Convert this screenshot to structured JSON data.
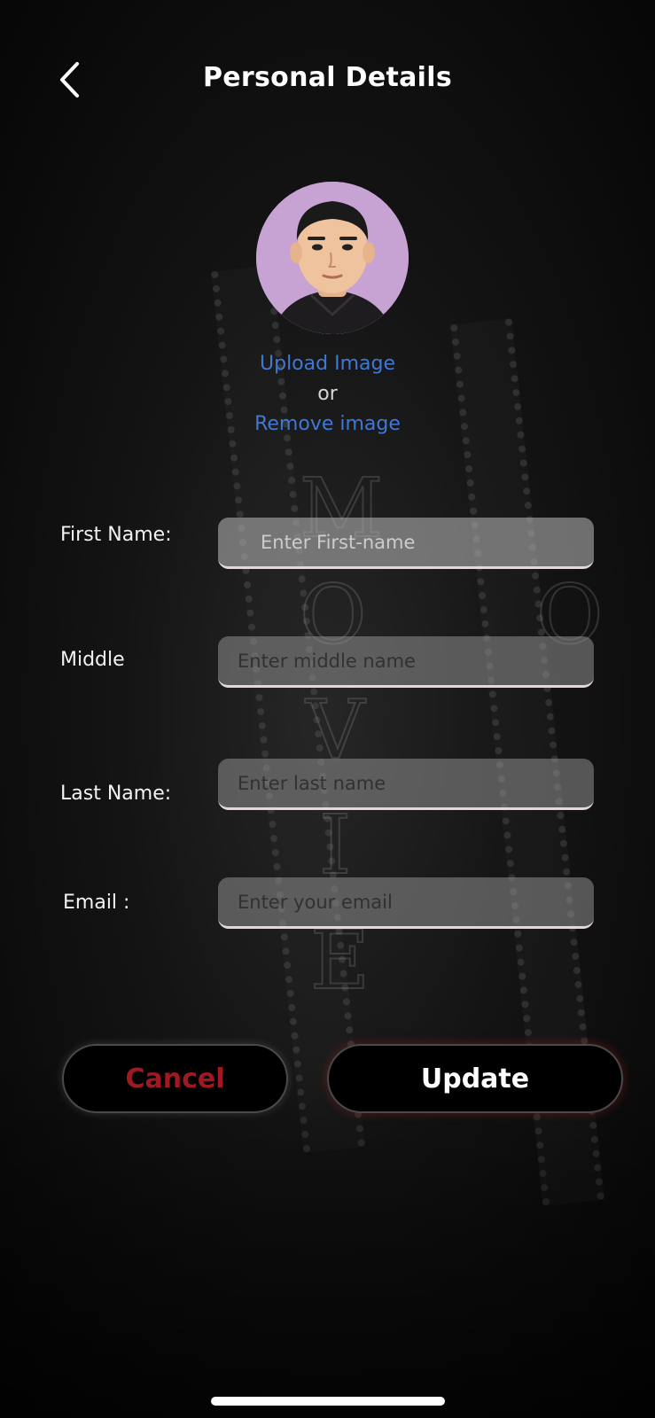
{
  "header": {
    "title": "Personal Details",
    "back_icon": "chevron-left-icon"
  },
  "profile": {
    "avatar_bg": "#c7a3d3",
    "upload_label": "Upload Image",
    "or_label": "or",
    "remove_label": "Remove image"
  },
  "form": {
    "first_name": {
      "label": "First Name:",
      "placeholder": "Enter First-name",
      "value": ""
    },
    "middle_name": {
      "label": "Middle",
      "placeholder": "Enter middle name",
      "value": ""
    },
    "last_name": {
      "label": "Last Name:",
      "placeholder": "Enter last name",
      "value": ""
    },
    "email": {
      "label": "Email :",
      "placeholder": "Enter your email",
      "value": ""
    }
  },
  "actions": {
    "cancel_label": "Cancel",
    "update_label": "Update"
  },
  "colors": {
    "link": "#3f78d6",
    "cancel_text": "#a01820",
    "background": "#0b0b0b"
  }
}
